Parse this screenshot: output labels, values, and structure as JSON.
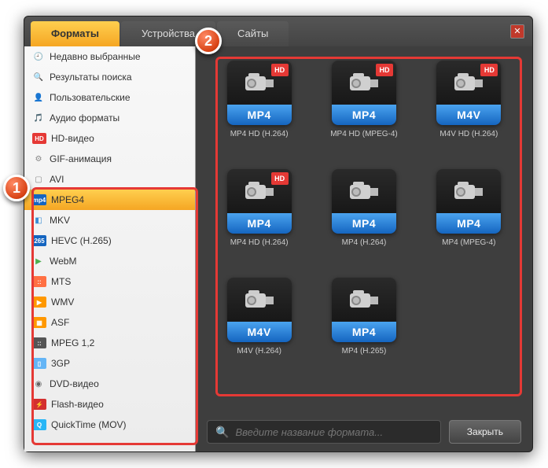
{
  "tabs": [
    {
      "label": "Форматы",
      "active": true
    },
    {
      "label": "Устройства",
      "active": false
    },
    {
      "label": "Сайты",
      "active": false
    }
  ],
  "closeX": "✕",
  "sidebar": [
    {
      "label": "Недавно выбранные",
      "icon": "clock",
      "iconColor": "#f5a623"
    },
    {
      "label": "Результаты поиска",
      "icon": "search",
      "iconColor": "#666"
    },
    {
      "label": "Пользовательские",
      "icon": "user",
      "iconColor": "#666"
    },
    {
      "label": "Аудио форматы",
      "icon": "audio",
      "iconColor": "#3b8dd4"
    },
    {
      "label": "HD-видео",
      "icon": "hd",
      "iconColor": "#e53935"
    },
    {
      "label": "GIF-анимация",
      "icon": "gif",
      "iconColor": "#888"
    },
    {
      "label": "AVI",
      "icon": "box",
      "iconColor": "#888"
    },
    {
      "label": "MPEG4",
      "icon": "mp4",
      "iconColor": "#1565c0",
      "selected": true
    },
    {
      "label": "MKV",
      "icon": "mkv",
      "iconColor": "#3b8dd4"
    },
    {
      "label": "HEVC (H.265)",
      "icon": "265",
      "iconColor": "#1565c0"
    },
    {
      "label": "WebM",
      "icon": "play",
      "iconColor": "#4caf50"
    },
    {
      "label": "MTS",
      "icon": "mts",
      "iconColor": "#ff7043"
    },
    {
      "label": "WMV",
      "icon": "wmv",
      "iconColor": "#ff9800"
    },
    {
      "label": "ASF",
      "icon": "asf",
      "iconColor": "#ff9800"
    },
    {
      "label": "MPEG 1,2",
      "icon": "mpeg",
      "iconColor": "#555"
    },
    {
      "label": "3GP",
      "icon": "3gp",
      "iconColor": "#64b5f6"
    },
    {
      "label": "DVD-видео",
      "icon": "dvd",
      "iconColor": "#666"
    },
    {
      "label": "Flash-видео",
      "icon": "flash",
      "iconColor": "#d32f2f"
    },
    {
      "label": "QuickTime (MOV)",
      "icon": "qt",
      "iconColor": "#29b6f6"
    }
  ],
  "formats": [
    {
      "band": "MP4",
      "label": "MP4 HD (H.264)",
      "hd": true
    },
    {
      "band": "MP4",
      "label": "MP4 HD (MPEG-4)",
      "hd": true
    },
    {
      "band": "M4V",
      "label": "M4V HD (H.264)",
      "hd": true
    },
    {
      "band": "MP4",
      "label": "MP4 HD (H.264)",
      "hd": true
    },
    {
      "band": "MP4",
      "label": "MP4 (H.264)",
      "hd": false
    },
    {
      "band": "MP4",
      "label": "MP4 (MPEG-4)",
      "hd": false
    },
    {
      "band": "M4V",
      "label": "M4V (H.264)",
      "hd": false
    },
    {
      "band": "MP4",
      "label": "MP4 (H.265)",
      "hd": false
    }
  ],
  "hdBadge": "HD",
  "search": {
    "placeholder": "Введите название формата..."
  },
  "closeBtn": "Закрыть",
  "markers": {
    "m1": "1",
    "m2": "2"
  }
}
